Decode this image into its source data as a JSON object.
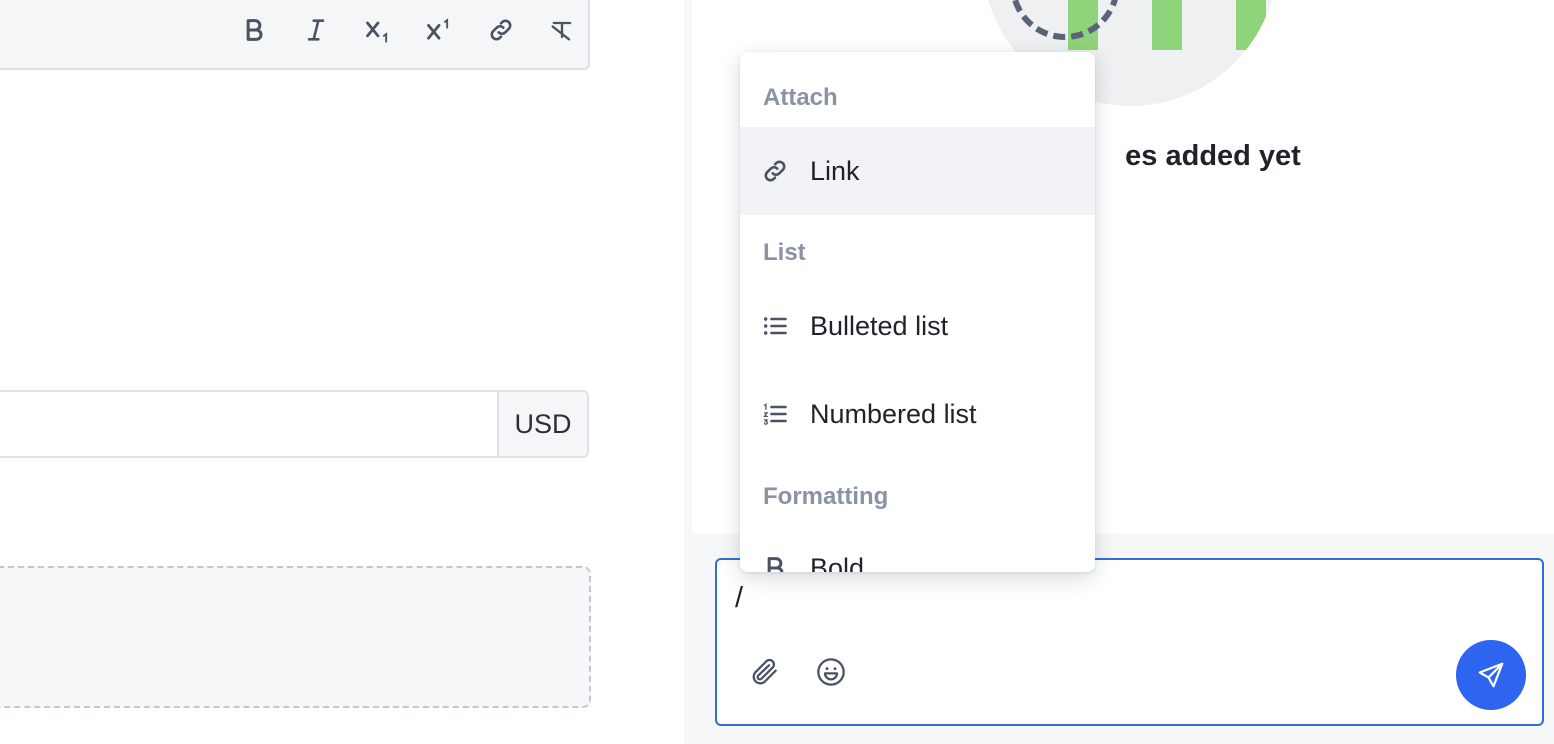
{
  "editor_toolbar": {
    "buttons": [
      {
        "name": "bold",
        "icon": "bold-icon"
      },
      {
        "name": "italic",
        "icon": "italic-icon"
      },
      {
        "name": "subscript",
        "icon": "subscript-icon"
      },
      {
        "name": "superscript",
        "icon": "superscript-icon"
      },
      {
        "name": "link",
        "icon": "link-icon"
      },
      {
        "name": "clear-formatting",
        "icon": "clear-format-icon"
      }
    ]
  },
  "price_field": {
    "value": "",
    "currency": "USD"
  },
  "notes_panel": {
    "empty_text": "es added yet"
  },
  "composer": {
    "text": "/",
    "attach_icon": "paperclip-icon",
    "emoji_icon": "smiley-icon",
    "send_icon": "send-icon",
    "send_color": "#2d64f0"
  },
  "slash_menu": {
    "groups": {
      "attach": "Attach",
      "list": "List",
      "formatting": "Formatting"
    },
    "items": {
      "link": {
        "label": "Link",
        "icon": "link-icon"
      },
      "bulleted": {
        "label": "Bulleted list",
        "icon": "bulleted-list-icon"
      },
      "numbered": {
        "label": "Numbered list",
        "icon": "numbered-list-icon"
      },
      "bold": {
        "label": "Bold",
        "icon": "bold-icon"
      }
    }
  },
  "colors": {
    "accent": "#2f6fdc",
    "menu_hover": "#f1f3f6",
    "group_label": "#8a93a3"
  }
}
